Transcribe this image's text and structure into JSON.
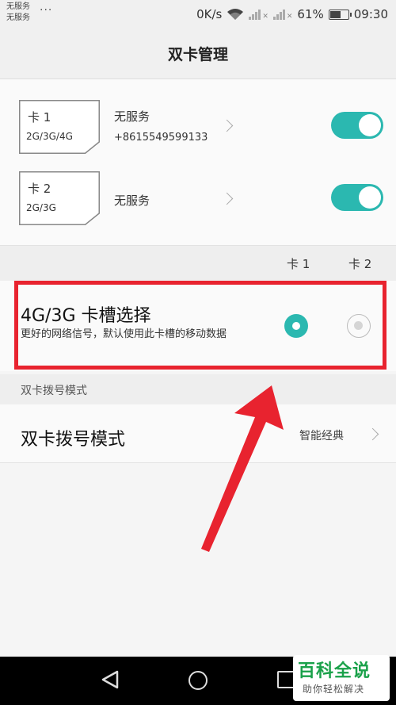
{
  "status_bar": {
    "carrier_1": "无服务",
    "carrier_2": "无服务",
    "more": "···",
    "speed": "0K/s",
    "battery": "61%",
    "battery_level": 61,
    "time": "09:30"
  },
  "header": {
    "title": "双卡管理"
  },
  "sims": [
    {
      "name": "卡 1",
      "network": "2G/3G/4G",
      "status": "无服务",
      "number": "+8615549599133",
      "enabled": true
    },
    {
      "name": "卡 2",
      "network": "2G/3G",
      "status": "无服务",
      "enabled": true
    }
  ],
  "slot_columns": {
    "card1": "卡 1",
    "card2": "卡 2"
  },
  "network_slot": {
    "title": "4G/3G 卡槽选择",
    "description": "更好的网络信号，默认使用此卡槽的移动数据",
    "selected": "card1"
  },
  "dial_section": {
    "header": "双卡拨号模式",
    "title": "双卡拨号模式",
    "value": "智能经典"
  },
  "watermark": {
    "main": "百科全说",
    "sub": "助你轻松解决"
  },
  "colors": {
    "accent": "#2bb8b0",
    "highlight": "#e8232f",
    "watermark": "#1aa14a"
  }
}
